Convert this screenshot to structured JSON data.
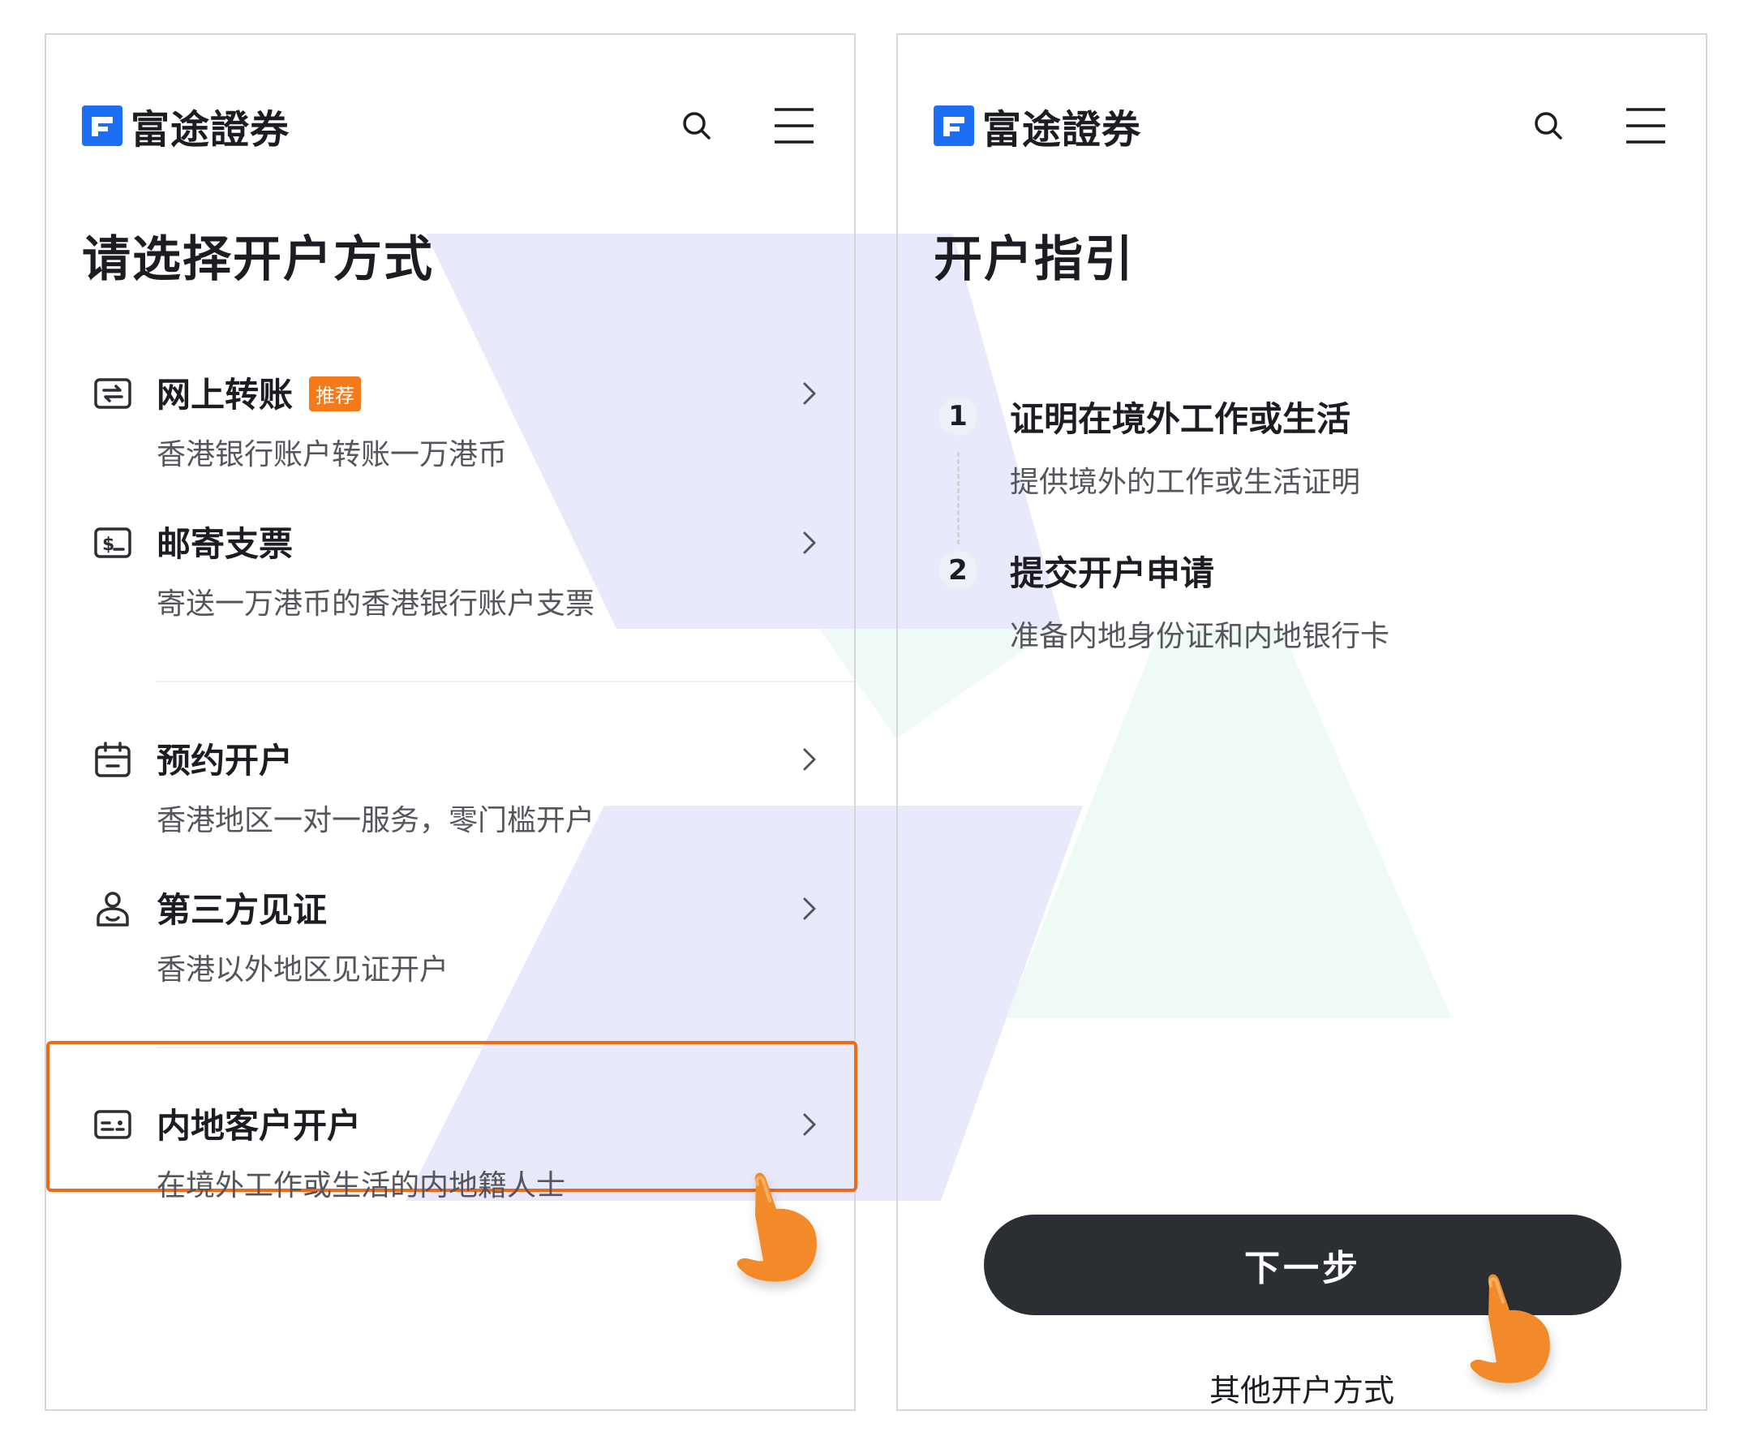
{
  "colors": {
    "brand_blue": "#1c6ff2",
    "highlight_orange": "#ee6a19",
    "badge_orange": "#f57a1a",
    "button_dark": "#2b2e33",
    "hand_orange": "#f28a2a",
    "bg_lavender": "#e8e9fb",
    "bg_mint": "#eefaf3"
  },
  "left_screen": {
    "logo_text": "富途證券",
    "header_icons": [
      "search-icon",
      "menu-icon"
    ],
    "title": "请选择开户方式",
    "options": [
      {
        "icon": "transfer-icon",
        "title": "网上转账",
        "badge": "推荐",
        "desc": "香港银行账户转账一万港币"
      },
      {
        "icon": "cheque-icon",
        "title": "邮寄支票",
        "badge": "",
        "desc": "寄送一万港币的香港银行账户支票"
      },
      {
        "icon": "calendar-icon",
        "title": "预约开户",
        "badge": "",
        "desc": "香港地区一对一服务，零门槛开户"
      },
      {
        "icon": "person-icon",
        "title": "第三方见证",
        "badge": "",
        "desc": "香港以外地区见证开户"
      },
      {
        "icon": "id-card-icon",
        "title": "内地客户开户",
        "badge": "",
        "desc": "在境外工作或生活的内地籍人士",
        "highlighted": true
      }
    ]
  },
  "right_screen": {
    "logo_text": "富途證券",
    "header_icons": [
      "search-icon",
      "menu-icon"
    ],
    "title": "开户指引",
    "steps": [
      {
        "num": "1",
        "title": "证明在境外工作或生活",
        "desc": "提供境外的工作或生活证明"
      },
      {
        "num": "2",
        "title": "提交开户申请",
        "desc": "准备内地身份证和内地银行卡"
      }
    ],
    "primary_button": "下一步",
    "secondary_link": "其他开户方式"
  }
}
